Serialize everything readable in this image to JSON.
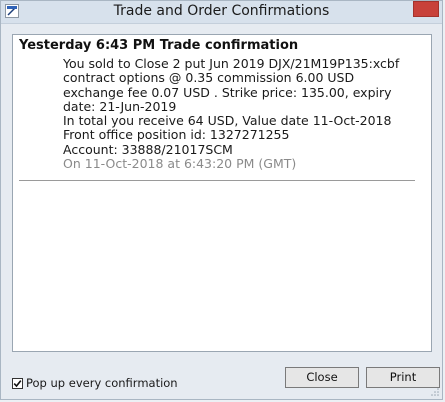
{
  "window": {
    "title": "Trade and Order Confirmations"
  },
  "message": {
    "heading": "Yesterday 6:43 PM Trade confirmation",
    "lines": [
      "You sold to Close 2 put Jun 2019 DJX/21M19P135:xcbf",
      "contract options @ 0.35 commission 6.00 USD",
      "exchange fee 0.07 USD . Strike price: 135.00, expiry date: 21-Jun-2019",
      "In total you receive 64 USD, Value date 11-Oct-2018",
      "Front office position id: 1327271255",
      "Account: 33888/21017SCM"
    ],
    "timestamp": "On 11-Oct-2018 at 6:43:20 PM (GMT)"
  },
  "footer": {
    "checkbox_label": "Pop up every confirmation",
    "checkbox_checked": true,
    "close_label": "Close",
    "print_label": "Print"
  }
}
